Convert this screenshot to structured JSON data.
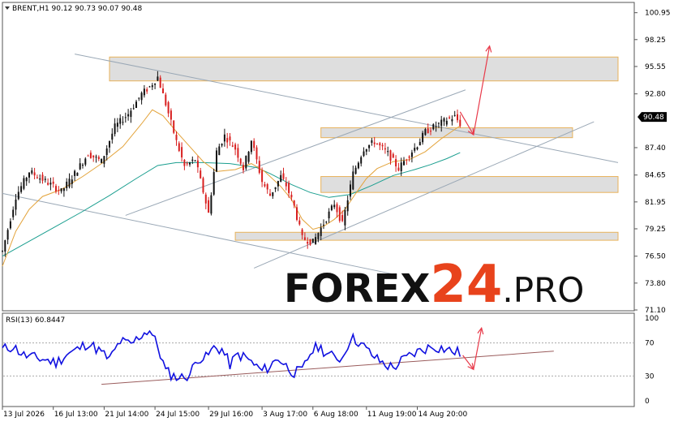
{
  "header": {
    "symbol_line": "BRENT,H1  90.12 90.73 90.07 90.48"
  },
  "rsi_header": "RSI(13) 60.8447",
  "watermark": {
    "forex": "FOREX",
    "num": "24",
    "pro": ".PRO",
    "colors": {
      "forex": "#111111",
      "num": "#e8431c",
      "pro": "#111111"
    }
  },
  "colors": {
    "bull_candle": "#111111",
    "bear_candle": "#d81f1f",
    "ma_fast": "#e3a33a",
    "ma_slow": "#1a9e8f",
    "rsi_line": "#1010e0",
    "channel_line": "#9aa8b6",
    "zone_fill": "#dedede",
    "zone_border": "#e8b25a",
    "arrow": "#e83a4a",
    "rsi_trend": "#9a5c5c",
    "current_price_box": "#000000"
  },
  "chart_data": [
    {
      "type": "candlestick",
      "title": "BRENT,H1",
      "ylim": [
        71.1,
        101.9
      ],
      "y_ticks": [
        "100.95",
        "98.25",
        "95.55",
        "92.80",
        "90.48",
        "87.40",
        "84.65",
        "81.95",
        "79.25",
        "76.50",
        "73.80",
        "71.10"
      ],
      "current_price": "90.48",
      "x_ticks": [
        "13 Jul 2026",
        "16 Jul 13:00",
        "21 Jul 14:00",
        "24 Jul 15:00",
        "29 Jul 16:00",
        "3 Aug 17:00",
        "6 Aug 18:00",
        "11 Aug 19:00",
        "14 Aug 20:00"
      ],
      "price_path": [
        [
          0,
          77.0
        ],
        [
          5,
          82.5
        ],
        [
          10,
          85.0
        ],
        [
          15,
          84.2
        ],
        [
          22,
          83.0
        ],
        [
          27,
          84.8
        ],
        [
          32,
          86.8
        ],
        [
          37,
          86.0
        ],
        [
          42,
          89.5
        ],
        [
          47,
          90.8
        ],
        [
          52,
          92.8
        ],
        [
          55,
          93.5
        ],
        [
          58,
          94.5
        ],
        [
          61,
          91.8
        ],
        [
          65,
          88.0
        ],
        [
          68,
          85.5
        ],
        [
          72,
          86.2
        ],
        [
          75,
          83.0
        ],
        [
          77,
          80.8
        ],
        [
          80,
          87.0
        ],
        [
          83,
          88.6
        ],
        [
          87,
          87.3
        ],
        [
          90,
          85.3
        ],
        [
          93,
          88.2
        ],
        [
          97,
          84.0
        ],
        [
          100,
          82.6
        ],
        [
          104,
          84.5
        ],
        [
          106,
          83.6
        ],
        [
          109,
          81.5
        ],
        [
          112,
          78.3
        ],
        [
          116,
          77.9
        ],
        [
          120,
          79.8
        ],
        [
          124,
          81.8
        ],
        [
          127,
          79.7
        ],
        [
          131,
          84.8
        ],
        [
          135,
          87.3
        ],
        [
          139,
          88.0
        ],
        [
          144,
          86.8
        ],
        [
          148,
          85.3
        ],
        [
          151,
          86.4
        ],
        [
          155,
          87.7
        ],
        [
          158,
          89.0
        ],
        [
          162,
          89.6
        ],
        [
          166,
          90.2
        ],
        [
          169,
          90.5
        ],
        [
          171,
          89.8
        ]
      ],
      "ma_fast": [
        [
          0,
          75.5
        ],
        [
          5,
          79.0
        ],
        [
          10,
          81.2
        ],
        [
          15,
          82.5
        ],
        [
          22,
          83.2
        ],
        [
          30,
          84.5
        ],
        [
          37,
          85.8
        ],
        [
          45,
          87.5
        ],
        [
          52,
          89.8
        ],
        [
          56,
          91.2
        ],
        [
          60,
          90.6
        ],
        [
          65,
          89.0
        ],
        [
          70,
          87.5
        ],
        [
          75,
          86.0
        ],
        [
          80,
          85.0
        ],
        [
          87,
          85.2
        ],
        [
          93,
          85.8
        ],
        [
          98,
          85.0
        ],
        [
          104,
          83.5
        ],
        [
          108,
          82.2
        ],
        [
          112,
          80.2
        ],
        [
          116,
          79.2
        ],
        [
          120,
          79.5
        ],
        [
          124,
          80.2
        ],
        [
          128,
          81.2
        ],
        [
          132,
          82.8
        ],
        [
          136,
          84.3
        ],
        [
          140,
          85.3
        ],
        [
          146,
          86.0
        ],
        [
          152,
          86.2
        ],
        [
          158,
          87.0
        ],
        [
          164,
          88.3
        ],
        [
          171,
          89.6
        ]
      ],
      "ma_slow": [
        [
          0,
          76.5
        ],
        [
          10,
          78.0
        ],
        [
          20,
          79.5
        ],
        [
          30,
          81.0
        ],
        [
          40,
          82.6
        ],
        [
          50,
          84.3
        ],
        [
          58,
          85.6
        ],
        [
          65,
          85.9
        ],
        [
          75,
          85.9
        ],
        [
          85,
          85.8
        ],
        [
          95,
          85.4
        ],
        [
          100,
          84.8
        ],
        [
          108,
          83.7
        ],
        [
          115,
          82.9
        ],
        [
          122,
          82.4
        ],
        [
          130,
          82.7
        ],
        [
          138,
          83.6
        ],
        [
          146,
          84.6
        ],
        [
          154,
          85.2
        ],
        [
          160,
          85.7
        ],
        [
          166,
          86.3
        ],
        [
          171,
          86.9
        ]
      ],
      "zones": [
        {
          "x1": 40,
          "x2": 230,
          "low": 94.1,
          "high": 96.5
        },
        {
          "x1": 119,
          "x2": 213,
          "low": 88.4,
          "high": 89.4
        },
        {
          "x1": 119,
          "x2": 230,
          "low": 82.9,
          "high": 84.5
        },
        {
          "x1": 87,
          "x2": 230,
          "low": 78.1,
          "high": 78.9
        }
      ],
      "channel_lines": [
        [
          [
            27,
            96.8
          ],
          [
            230,
            85.9
          ]
        ],
        [
          [
            0,
            82.8
          ],
          [
            146,
            74.7
          ]
        ],
        [
          [
            46,
            80.6
          ],
          [
            173,
            93.2
          ]
        ],
        [
          [
            94,
            75.3
          ],
          [
            221,
            90.0
          ]
        ]
      ],
      "arrows": [
        {
          "from": [
            171,
            91.0
          ],
          "to": [
            176,
            88.7
          ]
        },
        {
          "from": [
            176,
            88.7
          ],
          "to": [
            182,
            97.6
          ]
        }
      ]
    },
    {
      "type": "line",
      "title": "RSI(13) 60.8447",
      "ylim": [
        0,
        100
      ],
      "y_ticks": [
        "100",
        "70",
        "30",
        "0"
      ],
      "levels": [
        70,
        30
      ],
      "rsi": [
        [
          0,
          62
        ],
        [
          4,
          66
        ],
        [
          8,
          55
        ],
        [
          12,
          52
        ],
        [
          16,
          50
        ],
        [
          20,
          46
        ],
        [
          24,
          56
        ],
        [
          28,
          62
        ],
        [
          32,
          70
        ],
        [
          36,
          61
        ],
        [
          40,
          50
        ],
        [
          44,
          72
        ],
        [
          48,
          68
        ],
        [
          52,
          80
        ],
        [
          55,
          86
        ],
        [
          58,
          66
        ],
        [
          61,
          36
        ],
        [
          64,
          30
        ],
        [
          67,
          28
        ],
        [
          70,
          32
        ],
        [
          73,
          52
        ],
        [
          76,
          52
        ],
        [
          79,
          64
        ],
        [
          82,
          62
        ],
        [
          85,
          44
        ],
        [
          88,
          56
        ],
        [
          91,
          52
        ],
        [
          94,
          44
        ],
        [
          97,
          36
        ],
        [
          100,
          42
        ],
        [
          103,
          52
        ],
        [
          106,
          42
        ],
        [
          109,
          34
        ],
        [
          112,
          36
        ],
        [
          115,
          58
        ],
        [
          118,
          66
        ],
        [
          121,
          58
        ],
        [
          124,
          52
        ],
        [
          127,
          52
        ],
        [
          130,
          76
        ],
        [
          133,
          72
        ],
        [
          136,
          62
        ],
        [
          140,
          50
        ],
        [
          143,
          44
        ],
        [
          146,
          40
        ],
        [
          149,
          48
        ],
        [
          153,
          56
        ],
        [
          157,
          62
        ],
        [
          161,
          66
        ],
        [
          165,
          63
        ],
        [
          168,
          60
        ],
        [
          171,
          58
        ]
      ],
      "trendline": [
        [
          37,
          20
        ],
        [
          206,
          60
        ]
      ],
      "arrows": [
        {
          "from": [
            172,
            55
          ],
          "to": [
            176,
            38
          ]
        },
        {
          "from": [
            176,
            38
          ],
          "to": [
            179,
            88
          ]
        }
      ]
    }
  ]
}
